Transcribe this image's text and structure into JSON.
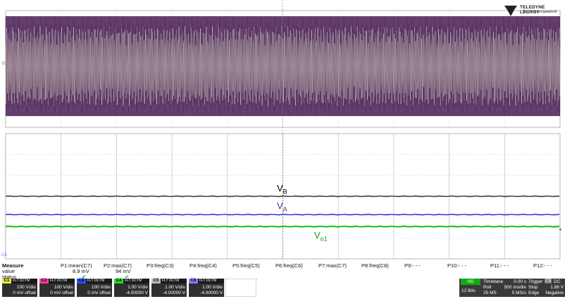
{
  "brand": {
    "name": "TELEDYNE LECROY",
    "tagline_pre": "Everywhere",
    "tagline_bold": "you",
    "tagline_post": "look"
  },
  "markers": {
    "upper_left": "⊙",
    "lower_left": "C6",
    "right_arrow": "◂"
  },
  "trace_labels": {
    "vb": {
      "main": "V",
      "sub": "B",
      "color": "#111111"
    },
    "va": {
      "main": "V",
      "sub": "A",
      "color": "#5a2a8a"
    },
    "vo1": {
      "main": "V",
      "sub": "o1",
      "color": "#1aa01a"
    }
  },
  "colors": {
    "upper_trace_dark": "#4a1f55",
    "upper_trace_light": "#c9c4b7",
    "trace_black": "#333333",
    "trace_blue": "#2b2bd6",
    "trace_green": "#1ec21e",
    "grid": "#b5b5b5"
  },
  "measure": {
    "title": "Measure",
    "row_labels": [
      "value",
      "status"
    ],
    "params": [
      {
        "name": "P1:mean(C7)",
        "value": "8.9 mV",
        "status": "✔"
      },
      {
        "name": "P2:max(C7)",
        "value": "94 mV",
        "status": "✔"
      },
      {
        "name": "P3:freq(C3)",
        "value": "",
        "status": ""
      },
      {
        "name": "P4:freq(C4)",
        "value": "",
        "status": ""
      },
      {
        "name": "P5:freq(C5)",
        "value": "",
        "status": ""
      },
      {
        "name": "P6:freq(C6)",
        "value": "",
        "status": ""
      },
      {
        "name": "P7:max(C7)",
        "value": "",
        "status": ""
      },
      {
        "name": "P8:freq(C8)",
        "value": "",
        "status": ""
      },
      {
        "name": "P9:- - -",
        "value": "",
        "status": ""
      },
      {
        "name": "P10:- - -",
        "value": "",
        "status": ""
      },
      {
        "name": "P11:- - -",
        "value": "",
        "status": ""
      },
      {
        "name": "P12:- - -",
        "value": "",
        "status": ""
      }
    ]
  },
  "channels": [
    {
      "tag": "C1",
      "flags": "FLT DCTM",
      "line1": "100 V/div",
      "line2": "0 mV offset",
      "color": "#e8e830"
    },
    {
      "tag": "C2",
      "flags": "FLT DCTM",
      "line1": "100 V/div",
      "line2": "0 mV offset",
      "color": "#ff3b9a"
    },
    {
      "tag": "C3",
      "flags": "FLT DCTM",
      "line1": "100 V/div",
      "line2": "0 mV offset",
      "color": "#2b4bff"
    },
    {
      "tag": "C4",
      "flags": "FLT DCTM",
      "line1": "1.00 V/div",
      "line2": "-4.00000 V",
      "color": "#22dd22"
    },
    {
      "tag": "C5",
      "flags": "FLT DCTM",
      "line1": "1.00 V/div",
      "line2": "-4.00000 V",
      "color": "#bbbbbb"
    },
    {
      "tag": "C6",
      "flags": "FLT DCTM",
      "line1": "1.00 V/div",
      "line2": "-4.00000 V",
      "color": "#8080ff"
    }
  ],
  "timebase": {
    "hd": "HD",
    "bits": "12 Bits",
    "timebase_label": "Timebase",
    "timebase_value": "0.00 s",
    "mode": "Roll",
    "div": "500 ms/div",
    "samples": "25 MS",
    "rate": "5 MS/s",
    "trigger_label": "Trigger",
    "trigger_src": "C5",
    "trigger_coupling": "DC",
    "trigger_mode": "Stop",
    "trigger_level": "1.88 V",
    "trigger_type": "Edge",
    "trigger_slope": "Negative"
  }
}
